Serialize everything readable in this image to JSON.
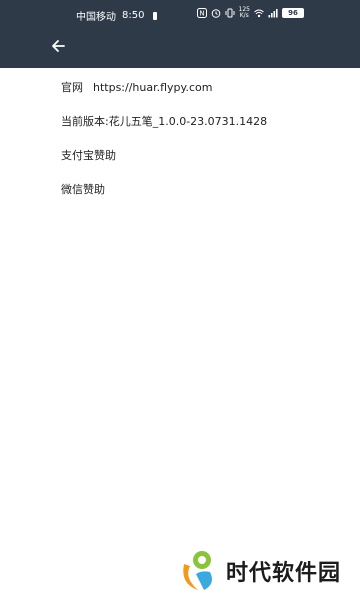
{
  "status_bar": {
    "carrier": "中国移动",
    "time": "8:50",
    "net_speed_top": "125",
    "net_speed_bottom": "K/s",
    "battery": "96"
  },
  "app_bar": {
    "back_icon": "arrow-left-icon",
    "background_color": "#2e3a48"
  },
  "items": [
    {
      "label": "官网",
      "value": "https://huar.flypy.com"
    },
    {
      "label": "当前版本:花儿五笔_1.0.0-23.0731.1428"
    },
    {
      "label": "支付宝赞助"
    },
    {
      "label": "微信赞助"
    }
  ],
  "watermark": {
    "text": "时代软件园"
  }
}
